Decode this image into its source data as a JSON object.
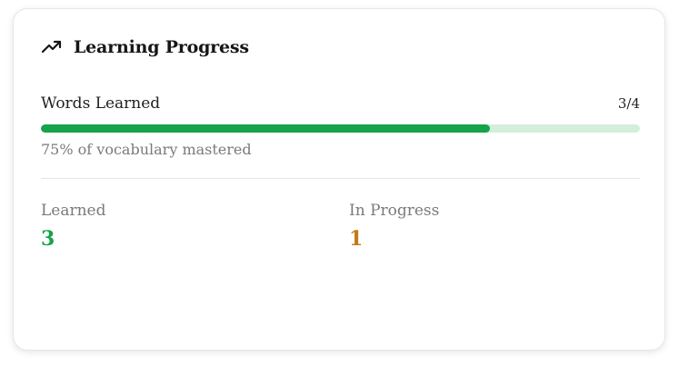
{
  "card": {
    "title": "Learning Progress",
    "title_icon": "trending-up-icon"
  },
  "words": {
    "label": "Words Learned",
    "count": "3/4",
    "progress_fraction": 0.75,
    "mastered_text": "75% of vocabulary mastered"
  },
  "stats": {
    "learned_label": "Learned",
    "learned_value": "3",
    "in_progress_label": "In Progress",
    "in_progress_value": "1"
  },
  "colors": {
    "progress_fill": "#16a34a",
    "progress_track": "#d3eedb",
    "learned_value": "#16a34a",
    "in_progress_value": "#c47a18"
  }
}
